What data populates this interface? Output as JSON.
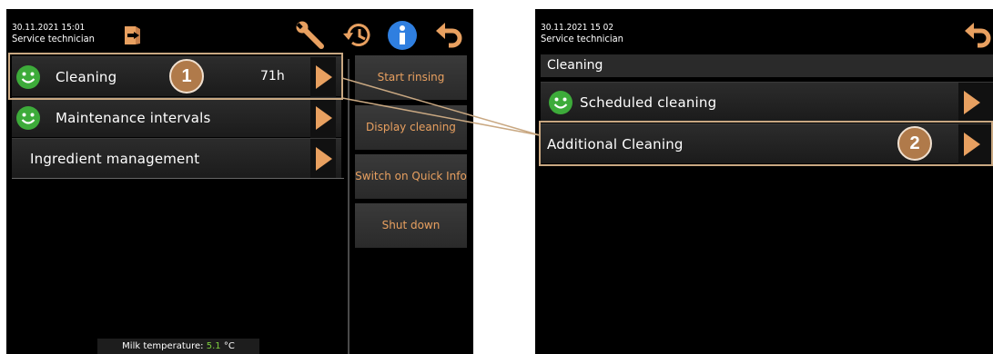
{
  "screen1": {
    "date_time": "30.11.2021 15:01",
    "role": "Service technician",
    "menu": [
      {
        "label": "Cleaning",
        "value": "71h",
        "status": "ok"
      },
      {
        "label": "Maintenance intervals",
        "status": "ok"
      },
      {
        "label": "Ingredient management"
      }
    ],
    "side_buttons": [
      "Start rinsing",
      "Display cleaning",
      "Switch on Quick Info",
      "Shut down"
    ],
    "milk_label": "Milk temperature:",
    "milk_value": "5.1",
    "milk_unit": "°C"
  },
  "screen2": {
    "date_time": "30.11.2021 15 02",
    "role": "Service technician",
    "section_title": "Cleaning",
    "menu": [
      {
        "label": "Scheduled cleaning",
        "status": "ok"
      },
      {
        "label": "Additional Cleaning"
      }
    ]
  },
  "callouts": [
    "1",
    "2"
  ],
  "colors": {
    "accent_orange": "#e8a060",
    "status_green": "#3dab3a",
    "info_blue": "#2f7fe0",
    "callout_fill": "#b07a4a",
    "highlight_border": "#c9a882",
    "milk_temp": "#7ecf3e"
  },
  "icons": [
    "logout-icon",
    "wrench-icon",
    "history-icon",
    "info-icon",
    "back-icon",
    "smiley-icon",
    "chevron-right-icon"
  ]
}
